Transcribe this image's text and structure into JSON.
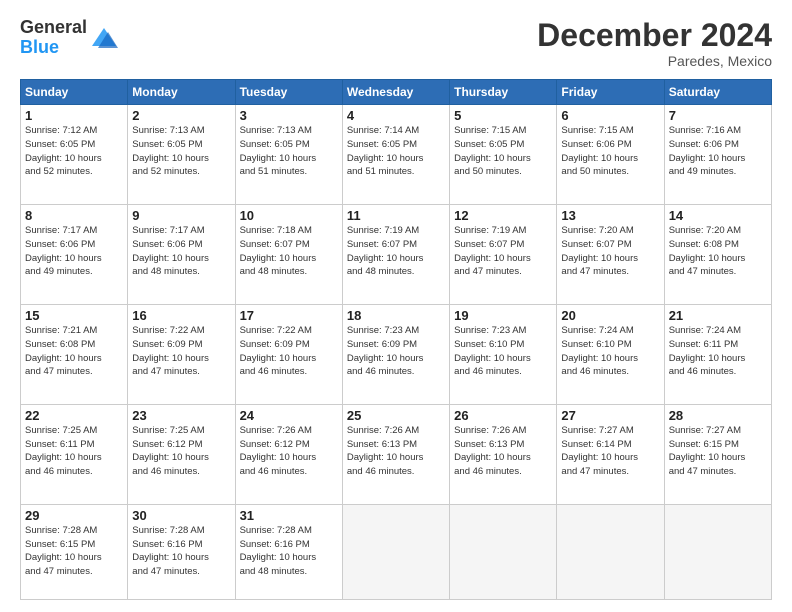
{
  "logo": {
    "general": "General",
    "blue": "Blue"
  },
  "title": "December 2024",
  "location": "Paredes, Mexico",
  "days_header": [
    "Sunday",
    "Monday",
    "Tuesday",
    "Wednesday",
    "Thursday",
    "Friday",
    "Saturday"
  ],
  "weeks": [
    [
      {
        "day": "1",
        "info": "Sunrise: 7:12 AM\nSunset: 6:05 PM\nDaylight: 10 hours\nand 52 minutes."
      },
      {
        "day": "2",
        "info": "Sunrise: 7:13 AM\nSunset: 6:05 PM\nDaylight: 10 hours\nand 52 minutes."
      },
      {
        "day": "3",
        "info": "Sunrise: 7:13 AM\nSunset: 6:05 PM\nDaylight: 10 hours\nand 51 minutes."
      },
      {
        "day": "4",
        "info": "Sunrise: 7:14 AM\nSunset: 6:05 PM\nDaylight: 10 hours\nand 51 minutes."
      },
      {
        "day": "5",
        "info": "Sunrise: 7:15 AM\nSunset: 6:05 PM\nDaylight: 10 hours\nand 50 minutes."
      },
      {
        "day": "6",
        "info": "Sunrise: 7:15 AM\nSunset: 6:06 PM\nDaylight: 10 hours\nand 50 minutes."
      },
      {
        "day": "7",
        "info": "Sunrise: 7:16 AM\nSunset: 6:06 PM\nDaylight: 10 hours\nand 49 minutes."
      }
    ],
    [
      {
        "day": "8",
        "info": "Sunrise: 7:17 AM\nSunset: 6:06 PM\nDaylight: 10 hours\nand 49 minutes."
      },
      {
        "day": "9",
        "info": "Sunrise: 7:17 AM\nSunset: 6:06 PM\nDaylight: 10 hours\nand 48 minutes."
      },
      {
        "day": "10",
        "info": "Sunrise: 7:18 AM\nSunset: 6:07 PM\nDaylight: 10 hours\nand 48 minutes."
      },
      {
        "day": "11",
        "info": "Sunrise: 7:19 AM\nSunset: 6:07 PM\nDaylight: 10 hours\nand 48 minutes."
      },
      {
        "day": "12",
        "info": "Sunrise: 7:19 AM\nSunset: 6:07 PM\nDaylight: 10 hours\nand 47 minutes."
      },
      {
        "day": "13",
        "info": "Sunrise: 7:20 AM\nSunset: 6:07 PM\nDaylight: 10 hours\nand 47 minutes."
      },
      {
        "day": "14",
        "info": "Sunrise: 7:20 AM\nSunset: 6:08 PM\nDaylight: 10 hours\nand 47 minutes."
      }
    ],
    [
      {
        "day": "15",
        "info": "Sunrise: 7:21 AM\nSunset: 6:08 PM\nDaylight: 10 hours\nand 47 minutes."
      },
      {
        "day": "16",
        "info": "Sunrise: 7:22 AM\nSunset: 6:09 PM\nDaylight: 10 hours\nand 47 minutes."
      },
      {
        "day": "17",
        "info": "Sunrise: 7:22 AM\nSunset: 6:09 PM\nDaylight: 10 hours\nand 46 minutes."
      },
      {
        "day": "18",
        "info": "Sunrise: 7:23 AM\nSunset: 6:09 PM\nDaylight: 10 hours\nand 46 minutes."
      },
      {
        "day": "19",
        "info": "Sunrise: 7:23 AM\nSunset: 6:10 PM\nDaylight: 10 hours\nand 46 minutes."
      },
      {
        "day": "20",
        "info": "Sunrise: 7:24 AM\nSunset: 6:10 PM\nDaylight: 10 hours\nand 46 minutes."
      },
      {
        "day": "21",
        "info": "Sunrise: 7:24 AM\nSunset: 6:11 PM\nDaylight: 10 hours\nand 46 minutes."
      }
    ],
    [
      {
        "day": "22",
        "info": "Sunrise: 7:25 AM\nSunset: 6:11 PM\nDaylight: 10 hours\nand 46 minutes."
      },
      {
        "day": "23",
        "info": "Sunrise: 7:25 AM\nSunset: 6:12 PM\nDaylight: 10 hours\nand 46 minutes."
      },
      {
        "day": "24",
        "info": "Sunrise: 7:26 AM\nSunset: 6:12 PM\nDaylight: 10 hours\nand 46 minutes."
      },
      {
        "day": "25",
        "info": "Sunrise: 7:26 AM\nSunset: 6:13 PM\nDaylight: 10 hours\nand 46 minutes."
      },
      {
        "day": "26",
        "info": "Sunrise: 7:26 AM\nSunset: 6:13 PM\nDaylight: 10 hours\nand 46 minutes."
      },
      {
        "day": "27",
        "info": "Sunrise: 7:27 AM\nSunset: 6:14 PM\nDaylight: 10 hours\nand 47 minutes."
      },
      {
        "day": "28",
        "info": "Sunrise: 7:27 AM\nSunset: 6:15 PM\nDaylight: 10 hours\nand 47 minutes."
      }
    ],
    [
      {
        "day": "29",
        "info": "Sunrise: 7:28 AM\nSunset: 6:15 PM\nDaylight: 10 hours\nand 47 minutes."
      },
      {
        "day": "30",
        "info": "Sunrise: 7:28 AM\nSunset: 6:16 PM\nDaylight: 10 hours\nand 47 minutes."
      },
      {
        "day": "31",
        "info": "Sunrise: 7:28 AM\nSunset: 6:16 PM\nDaylight: 10 hours\nand 48 minutes."
      },
      {
        "day": "",
        "info": ""
      },
      {
        "day": "",
        "info": ""
      },
      {
        "day": "",
        "info": ""
      },
      {
        "day": "",
        "info": ""
      }
    ]
  ]
}
